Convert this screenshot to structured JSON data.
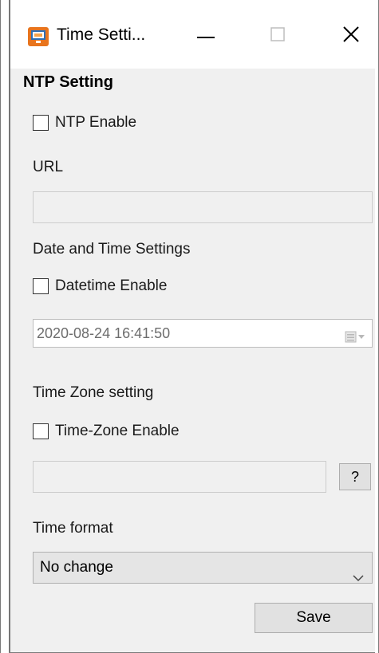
{
  "window": {
    "title": "Time Setti...",
    "minimize_icon": "minimize-icon",
    "maximize_icon": "maximize-icon",
    "close_icon": "close-icon"
  },
  "ntp": {
    "section_title": "NTP Setting",
    "enable_label": "NTP Enable",
    "enabled": false,
    "url_label": "URL",
    "url_value": ""
  },
  "datetime": {
    "section_title": "Date and Time Settings",
    "enable_label": "Datetime Enable",
    "enabled": false,
    "value": "2020-08-24 16:41:50",
    "picker_icon": "calendar-dropdown-icon"
  },
  "timezone": {
    "section_title": "Time Zone setting",
    "enable_label": "Time-Zone Enable",
    "enabled": false,
    "value": "",
    "help_label": "?"
  },
  "time_format": {
    "label": "Time format",
    "selected": "No change"
  },
  "actions": {
    "save_label": "Save"
  },
  "colors": {
    "window_bg": "#f0f0f0",
    "titlebar_bg": "#ffffff",
    "button_bg": "#e1e1e1",
    "app_icon_orange": "#e8741d",
    "app_icon_blue": "#2f6fb5"
  }
}
